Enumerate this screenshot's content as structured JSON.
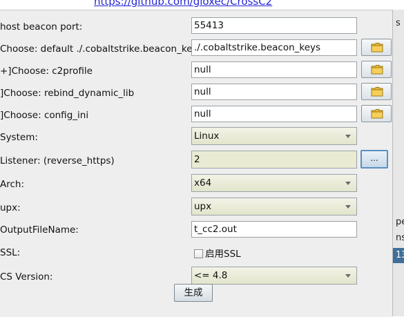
{
  "background": {
    "link_text": "https://github.com/gloxec/CrossC2",
    "right_column": [
      "s",
      "pe",
      "ns",
      "13"
    ]
  },
  "form": {
    "rows": [
      {
        "label": "host beacon port:",
        "value": "55413"
      },
      {
        "label": "Choose: default ./.cobaltstrike.beacon_keys",
        "value": "./.cobaltstrike.beacon_keys"
      },
      {
        "label": "+]Choose: c2profile",
        "value": "null"
      },
      {
        "label": "]Choose: rebind_dynamic_lib",
        "value": "null"
      },
      {
        "label": "]Choose: config_ini",
        "value": "null"
      },
      {
        "label": "System:",
        "value": "Linux"
      },
      {
        "label": "Listener: (reverse_https)",
        "value": "2",
        "button": "..."
      },
      {
        "label": "Arch:",
        "value": "x64"
      },
      {
        "label": "upx:",
        "value": "upx"
      },
      {
        "label": "OutputFileName:",
        "value": "t_cc2.out"
      },
      {
        "label": "SSL:",
        "checkbox_label": "启用SSL",
        "checked": false
      },
      {
        "label": "CS Version:",
        "value": "<= 4.8"
      }
    ],
    "generate_button": "生成"
  },
  "icons": {
    "folder": "folder-icon",
    "dropdown": "chevron-down-icon"
  },
  "colors": {
    "dialog_bg": "#eeeeee",
    "select_bg": "#e9ecd3",
    "focus_border": "#5a8fc0",
    "link": "#2323d6"
  }
}
